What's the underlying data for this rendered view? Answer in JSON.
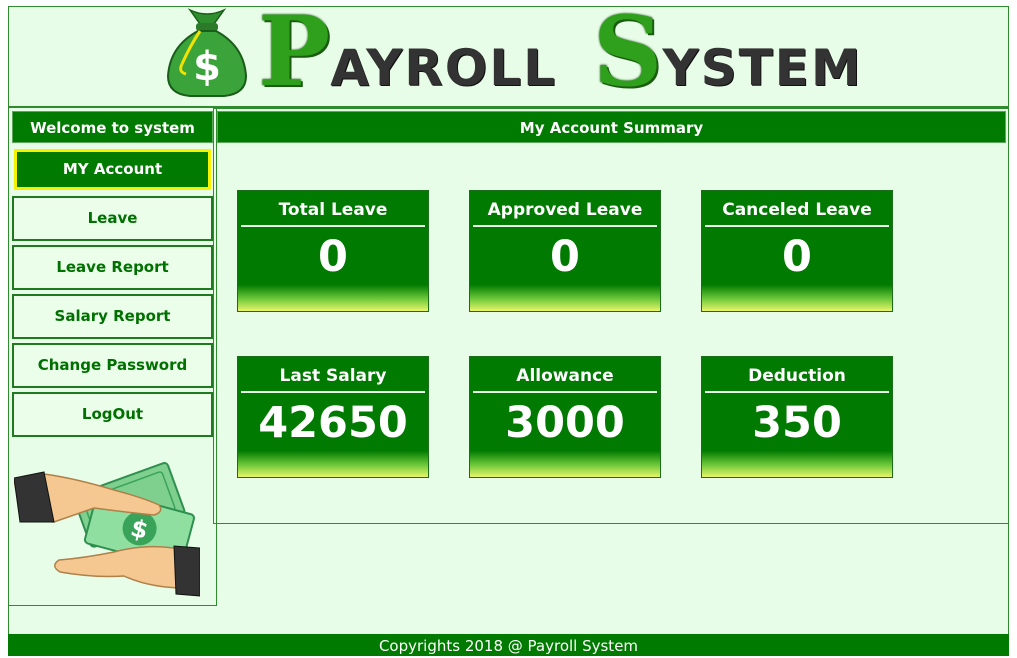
{
  "app": {
    "title_big_1": "P",
    "title_rest_1": "AYROLL",
    "title_big_2": "S",
    "title_rest_2": "YSTEM"
  },
  "sidebar": {
    "welcome": "Welcome to system",
    "items": [
      {
        "label": "MY Account",
        "active": true
      },
      {
        "label": "Leave"
      },
      {
        "label": "Leave Report"
      },
      {
        "label": "Salary Report"
      },
      {
        "label": "Change Password"
      },
      {
        "label": "LogOut"
      }
    ]
  },
  "main": {
    "title": "My Account Summary",
    "cards": [
      {
        "label": "Total Leave",
        "value": "0"
      },
      {
        "label": "Approved Leave",
        "value": "0"
      },
      {
        "label": "Canceled Leave",
        "value": "0"
      },
      {
        "label": "Last Salary",
        "value": "42650"
      },
      {
        "label": "Allowance",
        "value": "3000"
      },
      {
        "label": "Deduction",
        "value": "350"
      }
    ]
  },
  "footer": {
    "text": "Copyrights 2018 @ Payroll System"
  },
  "colors": {
    "primary_green": "#007a00",
    "background": "#e8fde8",
    "active_border": "#f4f400"
  },
  "icons": {
    "logo": "money-bag-icon",
    "illustration": "hands-money-icon"
  }
}
